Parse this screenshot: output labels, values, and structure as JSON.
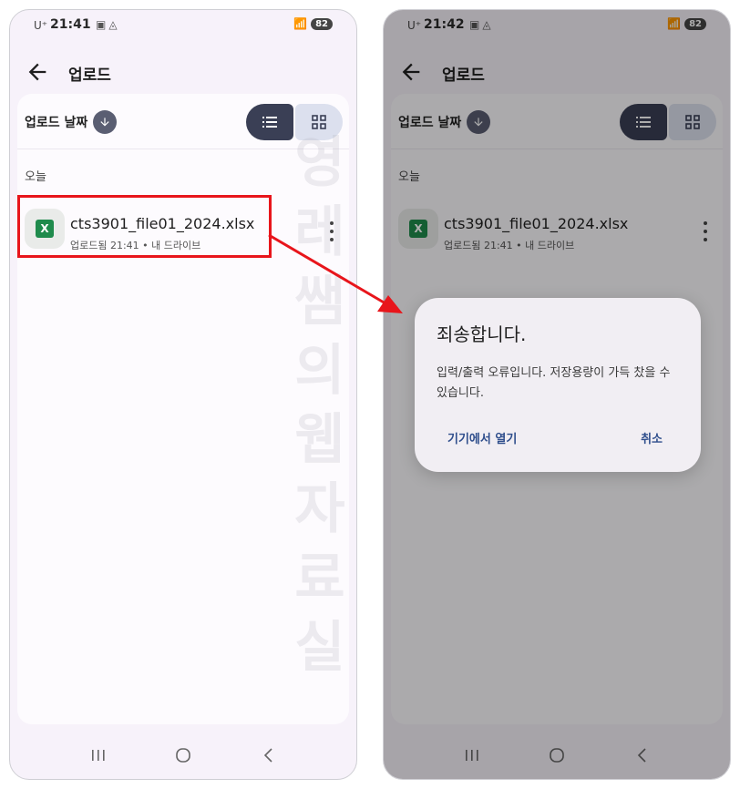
{
  "left": {
    "status": {
      "carrier": "U⁺",
      "time": "21:41",
      "battery": "82"
    },
    "title": "업로드",
    "sort_label": "업로드 날짜",
    "section_header": "오늘",
    "file": {
      "name": "cts3901_file01_2024.xlsx",
      "meta": "업로드됨 21:41 • 내 드라이브"
    },
    "watermark": "영레쌤의웹자료실"
  },
  "right": {
    "status": {
      "carrier": "U⁺",
      "time": "21:42",
      "battery": "82"
    },
    "title": "업로드",
    "sort_label": "업로드 날짜",
    "section_header": "오늘",
    "file": {
      "name": "cts3901_file01_2024.xlsx",
      "meta": "업로드됨 21:41 • 내 드라이브"
    },
    "dialog": {
      "title": "죄송합니다.",
      "body": "입력/출력 오류입니다. 저장용량이 가득 찼을 수 있습니다.",
      "open_on_device": "기기에서 열기",
      "cancel": "취소"
    }
  },
  "file_icon_letter": "X",
  "colors": {
    "highlight": "#e8151b",
    "dialog_button": "#2f4e8c",
    "excel_green": "#1f8b4c"
  },
  "icons": [
    "back-arrow-icon",
    "arrow-down-icon",
    "list-view-icon",
    "grid-view-icon",
    "more-vert-icon",
    "recents-icon",
    "home-icon",
    "back-nav-icon"
  ]
}
